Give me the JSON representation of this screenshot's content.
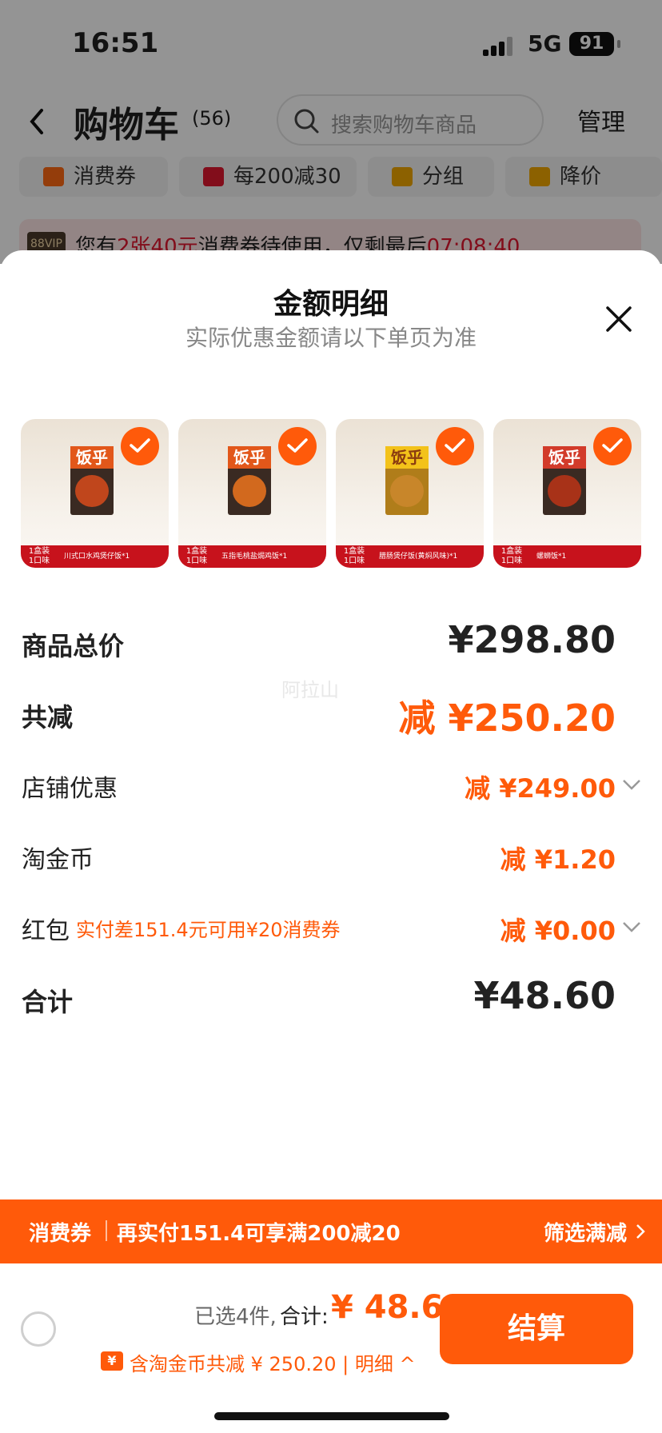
{
  "status": {
    "time": "16:51",
    "network": "5G",
    "battery": "91"
  },
  "cart": {
    "title": "购物车",
    "count": "(56)",
    "search_placeholder": "搜索购物车商品",
    "manage": "管理",
    "chips": [
      {
        "label": "消费券",
        "icon": "coupon-icon",
        "color": "#ff6a13"
      },
      {
        "label": "每200减30",
        "icon": "gift-icon",
        "color": "#e0172f"
      },
      {
        "label": "分组",
        "icon": "folder-icon",
        "color": "#f2a800"
      },
      {
        "label": "降价",
        "icon": "arrow-down-icon",
        "color": "#f2a800"
      }
    ],
    "vip_banner": {
      "badge": "88VIP",
      "text_pre": "您有",
      "count": "2张40元",
      "text_mid": "消费券待使用，仅剩最后",
      "countdown": "07:08:40"
    }
  },
  "sheet": {
    "title": "金额明细",
    "subtitle": "实际优惠金额请以下单页为准",
    "products": [
      {
        "brand": "饭乎",
        "tag_line1": "1盒装",
        "tag_line2": "1口味",
        "name": "川式口水鸡煲仔饭*1"
      },
      {
        "brand": "饭乎",
        "tag_line1": "1盒装",
        "tag_line2": "1口味",
        "name": "五指毛桃盐焗鸡饭*1"
      },
      {
        "brand": "饭乎",
        "tag_line1": "1盒装",
        "tag_line2": "1口味",
        "name": "腊肠煲仔饭(黄焖风味)*1"
      },
      {
        "brand": "饭乎",
        "tag_line1": "1盒装",
        "tag_line2": "1口味",
        "name": "螺蛳饭*1"
      }
    ],
    "rows": {
      "total_price": {
        "label": "商品总价",
        "amount": "¥298.80"
      },
      "total_discount": {
        "label": "共减",
        "amount": "减 ¥250.20"
      },
      "shop_discount": {
        "label": "店铺优惠",
        "amount": "减 ¥249.00"
      },
      "gold_coin": {
        "label": "淘金币",
        "amount": "减 ¥1.20"
      },
      "red_packet": {
        "label": "红包",
        "note": "实付差151.4元可用¥20消费券",
        "amount": "减 ¥0.00"
      },
      "sum": {
        "label": "合计",
        "amount": "¥48.60"
      }
    },
    "watermark": "阿拉山"
  },
  "coupon_bar": {
    "label": "消费券",
    "text": "再实付151.4可享满200减20",
    "link": "筛选满减"
  },
  "checkout_bar": {
    "selected": "已选4件,",
    "total_label": "合计:",
    "total_value": "¥ 48.60",
    "coin_icon": "¥",
    "savings": "含淘金币共减 ¥ 250.20 | 明细 ^",
    "button": "结算"
  },
  "colors": {
    "accent": "#ff5a0a",
    "red": "#e0172f"
  }
}
